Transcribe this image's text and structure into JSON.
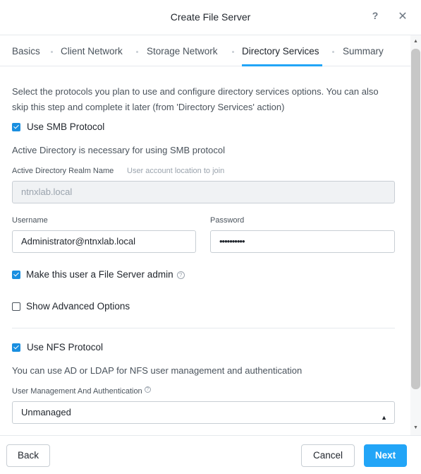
{
  "dialog": {
    "title": "Create File Server",
    "help_icon_glyph": "?",
    "close_icon_glyph": "✕"
  },
  "tabs": [
    {
      "label": "Basics",
      "active": false
    },
    {
      "label": "Client Network",
      "active": false
    },
    {
      "label": "Storage Network",
      "active": false
    },
    {
      "label": "Directory Services",
      "active": true
    },
    {
      "label": "Summary",
      "active": false
    }
  ],
  "intro": "Select the protocols you plan to use and configure directory services options. You can also skip this step and complete it later (from 'Directory Services' action)",
  "smb": {
    "checkbox_label": "Use SMB Protocol",
    "checked": true,
    "description": "Active Directory is necessary for using SMB protocol",
    "realm_label": "Active Directory Realm Name",
    "realm_hint": "User account location to join",
    "realm_value": "ntnxlab.local",
    "username_label": "Username",
    "username_value": "Administrator@ntnxlab.local",
    "password_label": "Password",
    "password_value": "••••••••••",
    "admin_label": "Make this user a File Server admin",
    "admin_checked": true,
    "advanced_label": "Show Advanced Options",
    "advanced_checked": false
  },
  "nfs": {
    "checkbox_label": "Use NFS Protocol",
    "checked": true,
    "description": "You can use AD or LDAP for NFS user management and authentication",
    "mgmt_label": "User Management And Authentication",
    "mgmt_value": "Unmanaged"
  },
  "footer": {
    "back_label": "Back",
    "cancel_label": "Cancel",
    "next_label": "Next"
  },
  "colors": {
    "accent": "#22a5f7",
    "checkbox": "#1a8fe0"
  }
}
